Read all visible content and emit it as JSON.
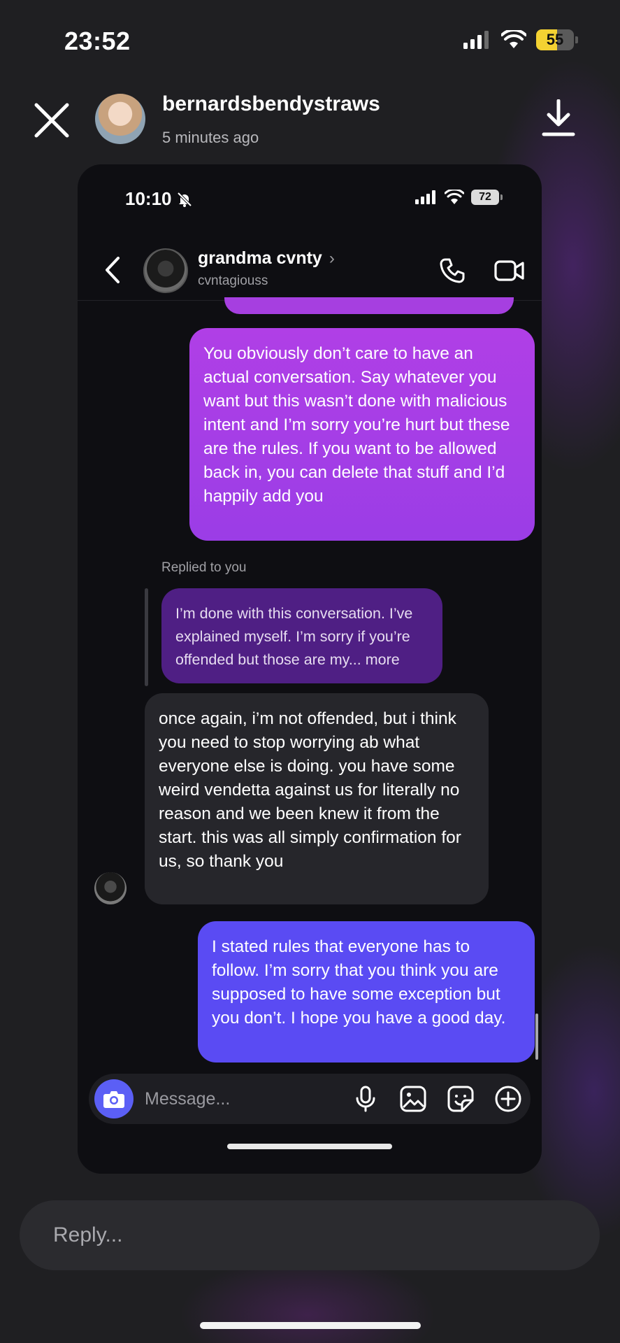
{
  "status_bar": {
    "time": "23:52",
    "battery": "55",
    "battery_level": 0.55
  },
  "story": {
    "username": "bernardsbendystraws",
    "time_ago": "5 minutes ago"
  },
  "screenshot": {
    "status_bar": {
      "time": "10:10",
      "battery": "72"
    },
    "chat_header": {
      "name": "grandma cvnty",
      "chevron": "›",
      "handle": "cvntagiouss"
    },
    "messages": [
      {
        "sender": "me",
        "text": "You obviously don’t care to have an actual conversation. Say whatever you want but this wasn’t done with malicious intent and I’m sorry you’re hurt but these are the rules. If you want to be allowed back in, you can delete that stuff and I’d happily add you"
      },
      {
        "sender": "them",
        "replied_label": "Replied to you",
        "quoted_text": "I’m done with this conversation. I’ve explained myself. I’m sorry if you’re offended but those are my... more",
        "text": "once again, i’m not offended, but i think you need to stop worrying ab what everyone else is doing. you have some weird vendetta against us for literally no reason  and we been knew it from the start. this was all simply confirmation for us, so thank you"
      },
      {
        "sender": "me",
        "text": "I stated rules that everyone has to follow. I’m sorry that you think you are supposed to have some exception but you don’t. I hope you have a good day."
      }
    ],
    "composer": {
      "placeholder": "Message..."
    }
  },
  "reply": {
    "placeholder": "Reply..."
  },
  "colors": {
    "sent_bubble_top": "#b03fe6",
    "sent_bubble_bottom": "#5a4bf3",
    "quoted_bubble": "#4f1f84",
    "received_bubble": "#26262b",
    "camera_button": "#5b5ff5"
  }
}
